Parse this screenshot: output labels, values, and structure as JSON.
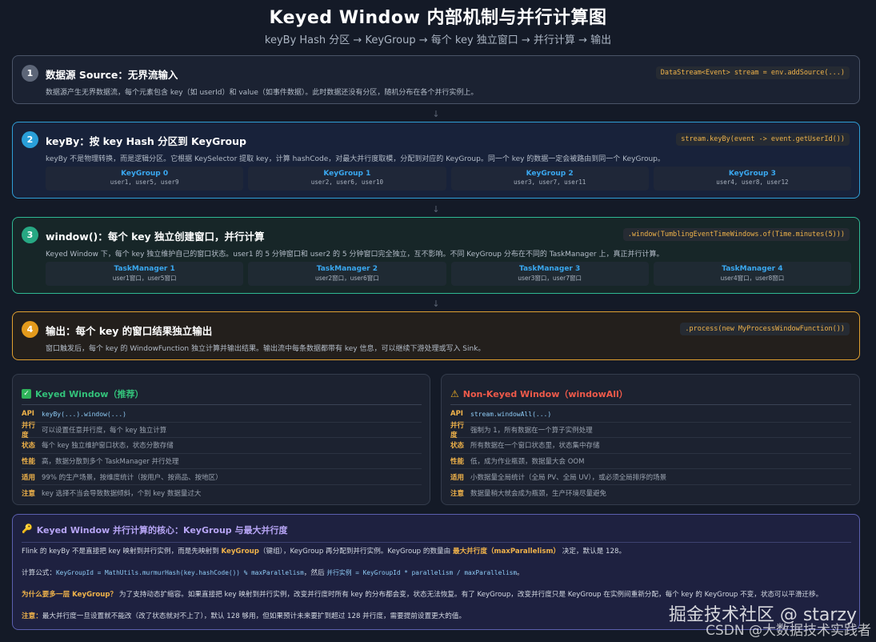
{
  "header": {
    "title": "Keyed Window 内部机制与并行计算图",
    "subtitle": "keyBy Hash 分区 → KeyGroup → 每个 key 独立窗口 → 并行计算 → 输出"
  },
  "steps": [
    {
      "number": "1",
      "title": "数据源 Source：无界流输入",
      "code": "DataStream<Event> stream = env.addSource(...)",
      "desc": "数据源产生无界数据流，每个元素包含 key（如 userId）和 value（如事件数据）。此时数据还没有分区，随机分布在各个并行实例上。"
    },
    {
      "number": "2",
      "title": "keyBy：按 key Hash 分区到 KeyGroup",
      "code": "stream.keyBy(event -> event.getUserId())",
      "desc": "keyBy 不是物理转换，而是逻辑分区。它根据 KeySelector 提取 key，计算 hashCode，对最大并行度取模，分配到对应的 KeyGroup。同一个 key 的数据一定会被路由到同一个 KeyGroup。",
      "boxes": [
        {
          "name": "KeyGroup 0",
          "detail": "user1, user5, user9"
        },
        {
          "name": "KeyGroup 1",
          "detail": "user2, user6, user10"
        },
        {
          "name": "KeyGroup 2",
          "detail": "user3, user7, user11"
        },
        {
          "name": "KeyGroup 3",
          "detail": "user4, user8, user12"
        }
      ]
    },
    {
      "number": "3",
      "title": "window()：每个 key 独立创建窗口，并行计算",
      "code": ".window(TumblingEventTimeWindows.of(Time.minutes(5)))",
      "desc": "Keyed Window 下，每个 key 独立维护自己的窗口状态。user1 的 5 分钟窗口和 user2 的 5 分钟窗口完全独立，互不影响。不同 KeyGroup 分布在不同的 TaskManager 上，真正并行计算。",
      "boxes": [
        {
          "name": "TaskManager 1",
          "detail": "user1窗口，user5窗口"
        },
        {
          "name": "TaskManager 2",
          "detail": "user2窗口，user6窗口"
        },
        {
          "name": "TaskManager 3",
          "detail": "user3窗口，user7窗口"
        },
        {
          "name": "TaskManager 4",
          "detail": "user4窗口，user8窗口"
        }
      ]
    },
    {
      "number": "4",
      "title": "输出：每个 key 的窗口结果独立输出",
      "code": ".process(new MyProcessWindowFunction())",
      "desc": "窗口触发后，每个 key 的 WindowFunction 独立计算并输出结果。输出流中每条数据都带有 key 信息，可以继续下游处理或写入 Sink。"
    }
  ],
  "arrow_glyph": "↓",
  "keyed": {
    "icon": "check-icon",
    "icon_glyph": "✓",
    "title": "Keyed Window（推荐）",
    "rows": [
      {
        "key": "API",
        "value": "keyBy(...).window(...)",
        "code": true
      },
      {
        "key": "并行度",
        "value": "可以设置任意并行度，每个 key 独立计算",
        "code": false
      },
      {
        "key": "状态",
        "value": "每个 key 独立维护窗口状态，状态分散存储",
        "code": false
      },
      {
        "key": "性能",
        "value": "高，数据分散到多个 TaskManager 并行处理",
        "code": false
      },
      {
        "key": "适用",
        "value": "99% 的生产场景，按维度统计（按用户、按商品、按地区）",
        "code": false
      },
      {
        "key": "注意",
        "value": "key 选择不当会导致数据倾斜，个别 key 数据量过大",
        "code": false
      }
    ]
  },
  "nonkeyed": {
    "icon": "warning-icon",
    "icon_glyph": "⚠",
    "title": "Non-Keyed Window（windowAll）",
    "rows": [
      {
        "key": "API",
        "value": "stream.windowAll(...)",
        "code": true
      },
      {
        "key": "并行度",
        "value": "强制为 1，所有数据在一个算子实例处理",
        "code": false
      },
      {
        "key": "状态",
        "value": "所有数据在一个窗口状态里，状态集中存储",
        "code": false
      },
      {
        "key": "性能",
        "value": "低，成为作业瓶颈，数据量大会 OOM",
        "code": false
      },
      {
        "key": "适用",
        "value": "小数据量全局统计（全局 PV、全局 UV），或必须全局排序的场景",
        "code": false
      },
      {
        "key": "注意",
        "value": "数据量稍大就会成为瓶颈，生产环境尽量避免",
        "code": false
      }
    ]
  },
  "core": {
    "icon": "key-icon",
    "icon_glyph": "🔑",
    "title": "Keyed Window 并行计算的核心：KeyGroup 与最大并行度",
    "p1_a": "Flink 的 keyBy 不是直接把 key 映射到并行实例，而是先映射到 ",
    "p1_hl1": "KeyGroup",
    "p1_b": "（键组），KeyGroup 再分配到并行实例。KeyGroup 的数量由 ",
    "p1_hl2": "最大并行度（maxParallelism）",
    "p1_c": " 决定，默认是 128。",
    "p2_a": "计算公式：",
    "p2_code1": "KeyGroupId = MathUtils.murmurHash(key.hashCode()) % maxParallelism",
    "p2_b": "，然后 ",
    "p2_code2": "并行实例 = KeyGroupId * parallelism / maxParallelism",
    "p2_c": "。",
    "p3_hl": "为什么要多一层 KeyGroup？",
    "p3_text": " 为了支持动态扩缩容。如果直接把 key 映射到并行实例，改变并行度时所有 key 的分布都会变，状态无法恢复。有了 KeyGroup，改变并行度只是 KeyGroup 在实例间重新分配，每个 key 的 KeyGroup 不变，状态可以平滑迁移。",
    "p4_hl": "注意：",
    "p4_text": "最大并行度一旦设置就不能改（改了状态就对不上了），默认 128 够用，但如果预计未来要扩到超过 128 并行度，需要提前设置更大的值。"
  },
  "watermark": {
    "line1": "掘金技术社区 @ starzy",
    "line2": "CSDN @大数据技术实践者"
  }
}
